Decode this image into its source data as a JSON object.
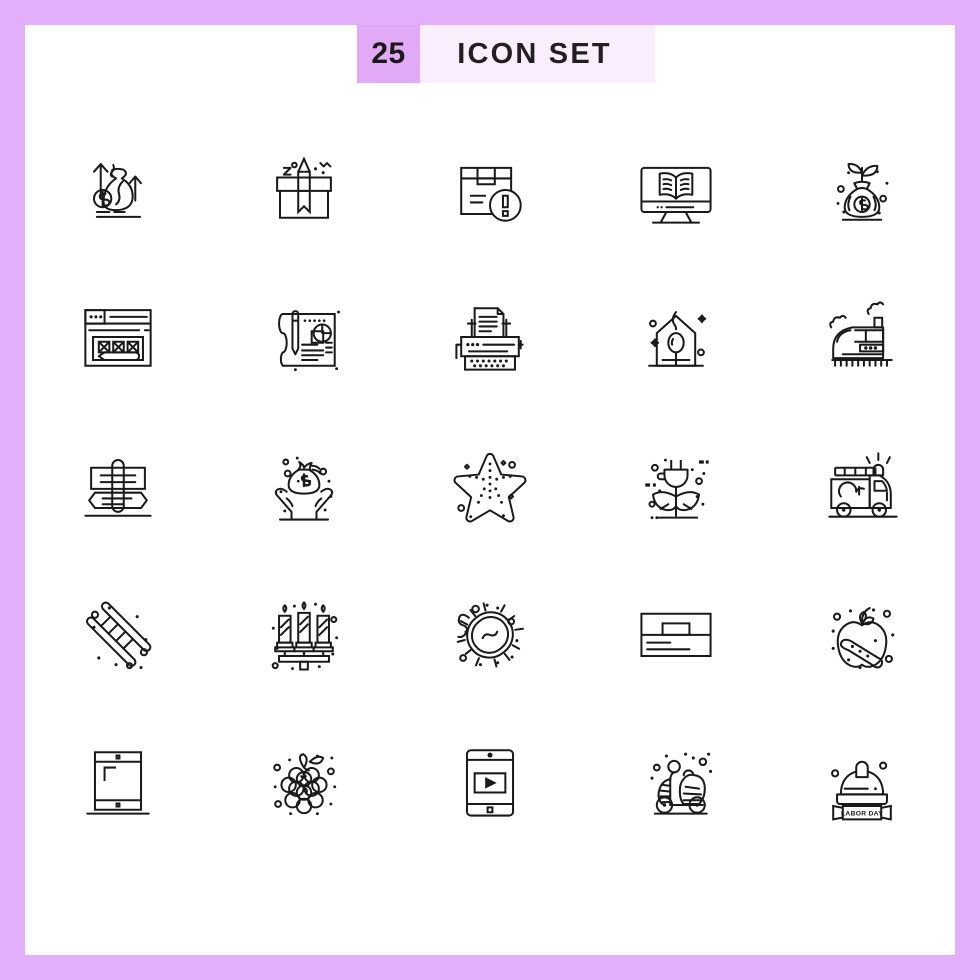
{
  "header": {
    "count": "25",
    "title": "ICON SET",
    "badge_color": "#e2a9f6",
    "band_color": "#f8eefd",
    "border_color": "#e3aefa",
    "panel_color": "#ffffff",
    "stroke_color": "#1a1a1a"
  },
  "grid": {
    "columns": 5,
    "rows": 5,
    "total": 25
  },
  "icons": [
    {
      "index": 1,
      "name": "money-bag-growth-icon",
      "label": "Money bag with rising arrows"
    },
    {
      "index": 2,
      "name": "gift-box-icon",
      "label": "Gift box with ribbon"
    },
    {
      "index": 3,
      "name": "package-alert-icon",
      "label": "Package with warning"
    },
    {
      "index": 4,
      "name": "online-book-monitor-icon",
      "label": "Monitor with open book"
    },
    {
      "index": 5,
      "name": "money-plant-bag-icon",
      "label": "Money bag with growing plant"
    },
    {
      "index": 6,
      "name": "web-form-design-icon",
      "label": "Browser window with form and pencil"
    },
    {
      "index": 7,
      "name": "blueprint-plan-icon",
      "label": "Blueprint with pen and chart"
    },
    {
      "index": 8,
      "name": "typewriter-icon",
      "label": "Typewriter with paper"
    },
    {
      "index": 9,
      "name": "birdhouse-icon",
      "label": "Birdhouse"
    },
    {
      "index": 10,
      "name": "locomotive-train-icon",
      "label": "Train with smoke"
    },
    {
      "index": 11,
      "name": "signpost-icon",
      "label": "Direction signpost"
    },
    {
      "index": 12,
      "name": "donation-hands-money-icon",
      "label": "Hands holding money bag"
    },
    {
      "index": 13,
      "name": "starfish-icon",
      "label": "Starfish"
    },
    {
      "index": 14,
      "name": "green-energy-plug-icon",
      "label": "Plug with leaves"
    },
    {
      "index": 15,
      "name": "fire-truck-icon",
      "label": "Fire truck"
    },
    {
      "index": 16,
      "name": "ladder-icon",
      "label": "Ladder"
    },
    {
      "index": 17,
      "name": "candelabra-icon",
      "label": "Three candles candelabra"
    },
    {
      "index": 18,
      "name": "bacteria-germ-icon",
      "label": "Bacteria cell"
    },
    {
      "index": 19,
      "name": "card-banner-icon",
      "label": "Card layout banner"
    },
    {
      "index": 20,
      "name": "apple-ring-icon",
      "label": "Apple with orbit ring"
    },
    {
      "index": 21,
      "name": "tablet-device-icon",
      "label": "Tablet device"
    },
    {
      "index": 22,
      "name": "grapes-berry-icon",
      "label": "Grape cluster"
    },
    {
      "index": 23,
      "name": "mobile-video-player-icon",
      "label": "Smartphone with video player"
    },
    {
      "index": 24,
      "name": "scooter-icon",
      "label": "Scooter"
    },
    {
      "index": 25,
      "name": "labor-day-helmet-icon",
      "label": "Hard hat with Labor Day ribbon"
    }
  ],
  "labels": {
    "labor_day_ribbon": "LABOR DAY"
  }
}
